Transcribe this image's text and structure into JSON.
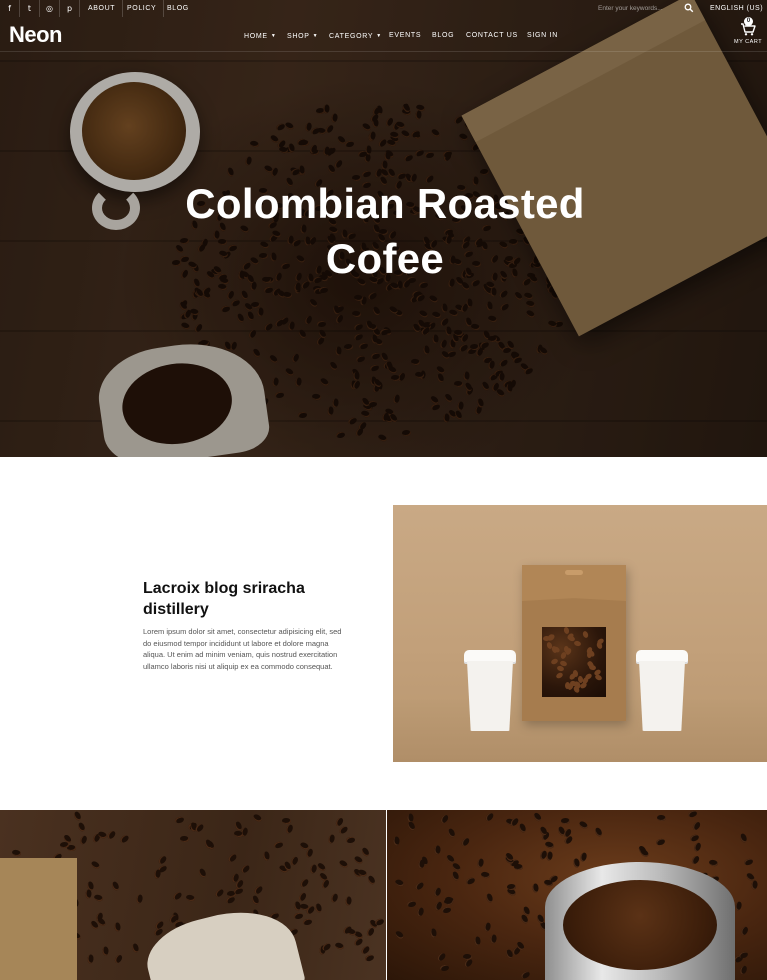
{
  "topbar": {
    "social": [
      {
        "name": "facebook-icon",
        "glyph": "f"
      },
      {
        "name": "twitter-icon",
        "glyph": "t"
      },
      {
        "name": "instagram-icon",
        "glyph": "◎"
      },
      {
        "name": "pinterest-icon",
        "glyph": "p"
      }
    ],
    "links": [
      "ABOUT",
      "POLICY",
      "BLOG"
    ],
    "search_placeholder": "Enter your keywords...",
    "language": "ENGLISH (US)"
  },
  "header": {
    "logo": "Neon",
    "nav": {
      "home": "HOME",
      "shop": "SHOP",
      "category": "CATEGORY",
      "events": "EVENTS",
      "blog": "BLOG",
      "contact": "CONTACT US",
      "signin": "SIGN IN"
    },
    "cart": {
      "count": "0",
      "label": "MY CART"
    }
  },
  "hero": {
    "title_line1": "Colombian Roasted",
    "title_line2": "Cofee"
  },
  "feature": {
    "heading_line1": "Lacroix blog sriracha",
    "heading_line2": "distillery",
    "body": "Lorem ipsum dolor sit amet, consectetur adipisicing elit, sed do eiusmod tempor incididunt ut labore et dolore magna aliqua. Ut enim ad minim veniam, quis nostrud exercitation ullamco laboris nisi ut aliquip ex ea commodo consequat."
  },
  "colors": {
    "accent": "#ffffff",
    "text_dark": "#111111",
    "body_text": "#555555",
    "hero_wood": "#4b3322",
    "kraft": "#a67c4e"
  }
}
